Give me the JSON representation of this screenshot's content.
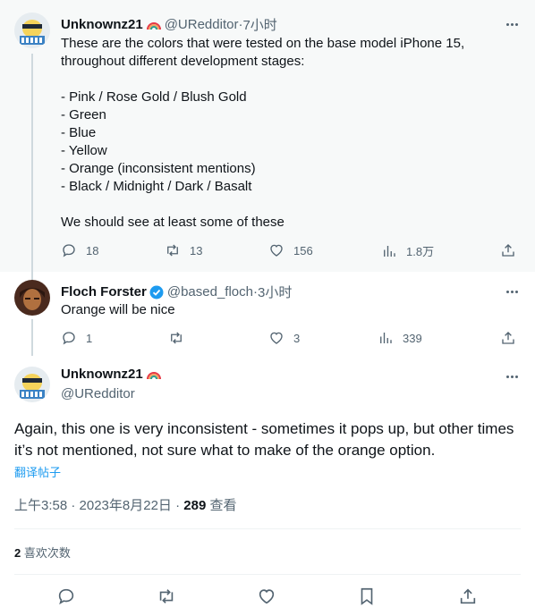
{
  "tweets": [
    {
      "name": "Unknownz21",
      "handle": "@URedditor",
      "time": "7小时",
      "text": "These are the colors that were tested on the base model iPhone 15,\nthroughout different development stages:\n\n- Pink / Rose Gold / Blush Gold\n- Green\n- Blue\n- Yellow\n- Orange (inconsistent mentions)\n- Black / Midnight / Dark / Basalt\n\nWe should see at least some of these",
      "replies": "18",
      "retweets": "13",
      "likes": "156",
      "views": "1.8万"
    },
    {
      "name": "Floch Forster",
      "handle": "@based_floch",
      "time": "3小时",
      "text": "Orange will be nice",
      "replies": "1",
      "retweets": "",
      "likes": "3",
      "views": "339"
    }
  ],
  "main": {
    "name": "Unknownz21",
    "handle": "@URedditor",
    "text": "Again, this one is very inconsistent - sometimes it pops up, but other times it’s not mentioned, not sure what to make of the orange option.",
    "translate": "翻译帖子",
    "timestamp": "上午3:58 · 2023年8月22日 · ",
    "views_count": "289",
    "views_label": " 查看",
    "likes_count": "2",
    "likes_label": " 喜欢次数"
  },
  "separator": " · ",
  "colors": {
    "accent": "#1d9bf0",
    "muted": "#536471",
    "verified": "#1d9bf0"
  }
}
